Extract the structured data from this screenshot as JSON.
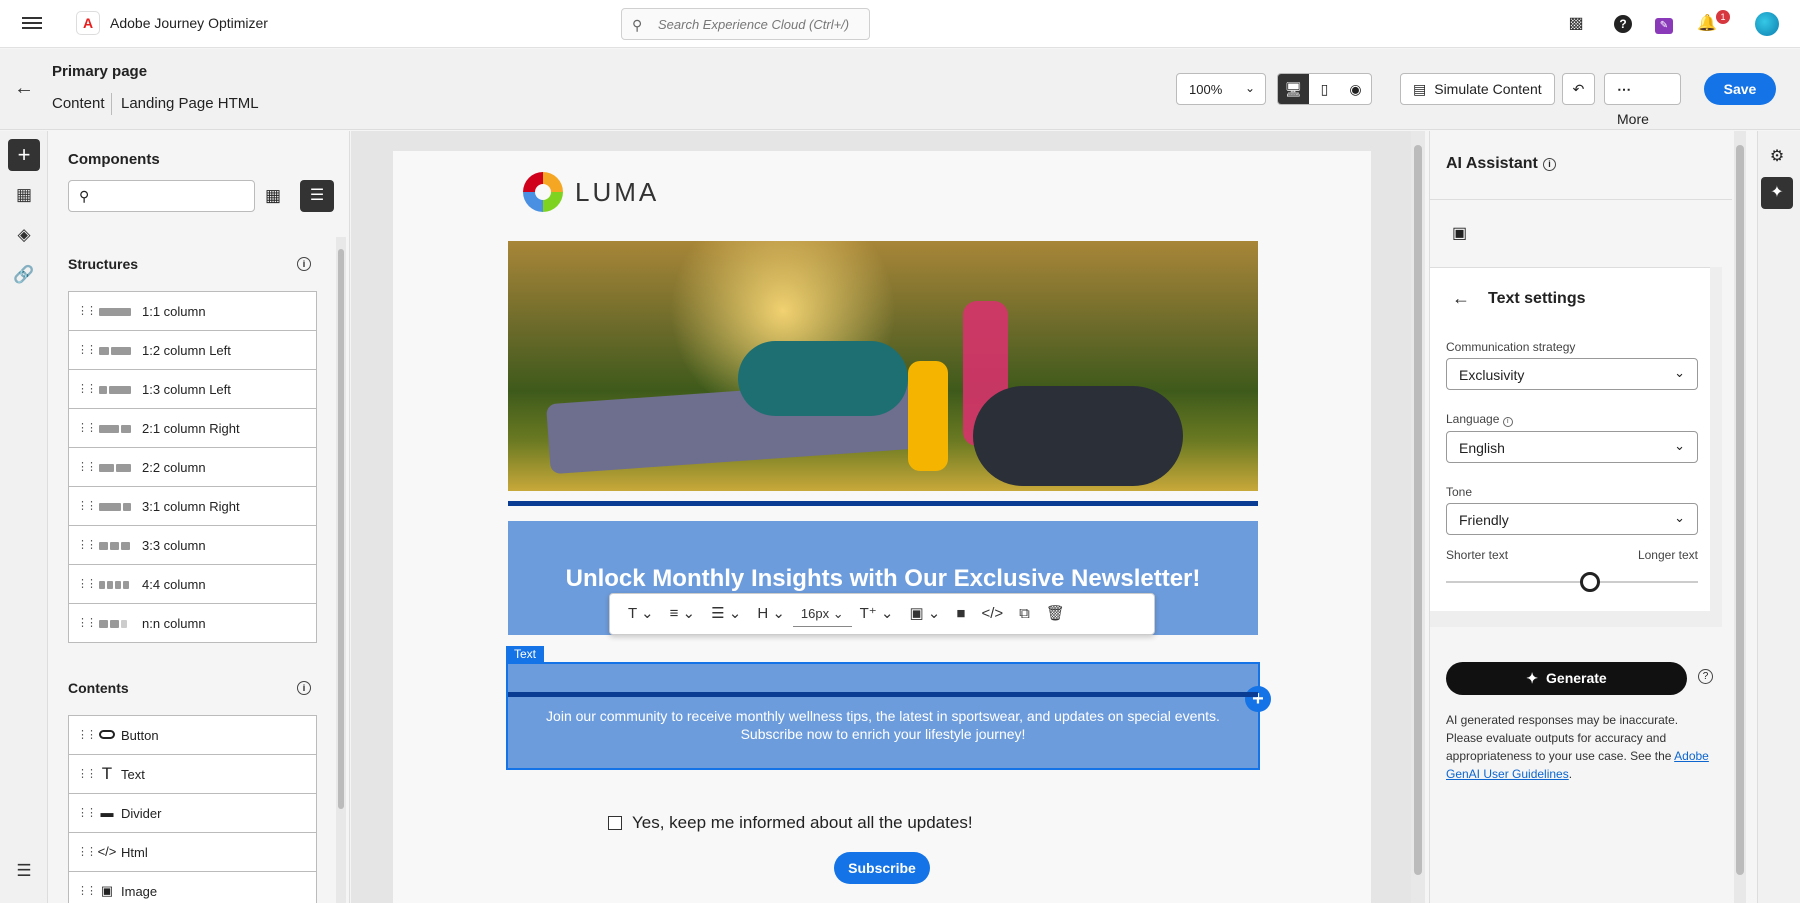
{
  "topbar": {
    "app_title": "Adobe Journey Optimizer",
    "search_placeholder": "Search Experience Cloud (Ctrl+/)",
    "notifications_count": "1"
  },
  "header": {
    "page_title": "Primary page",
    "breadcrumb_content": "Content",
    "breadcrumb_landing": "Landing Page HTML",
    "zoom": "100%",
    "simulate_label": "Simulate Content",
    "more_label": "More",
    "save_label": "Save"
  },
  "components": {
    "title": "Components",
    "structures_title": "Structures",
    "structures": [
      {
        "label": "1:1 column"
      },
      {
        "label": "1:2 column Left"
      },
      {
        "label": "1:3 column Left"
      },
      {
        "label": "2:1 column Right"
      },
      {
        "label": "2:2 column"
      },
      {
        "label": "3:1 column Right"
      },
      {
        "label": "3:3 column"
      },
      {
        "label": "4:4 column"
      },
      {
        "label": "n:n column"
      }
    ],
    "contents_title": "Contents",
    "contents": [
      {
        "label": "Button",
        "icon": "button-icon"
      },
      {
        "label": "Text",
        "icon": "text-icon"
      },
      {
        "label": "Divider",
        "icon": "divider-icon"
      },
      {
        "label": "Html",
        "icon": "code-icon"
      },
      {
        "label": "Image",
        "icon": "image-icon"
      }
    ]
  },
  "canvas": {
    "brand": "LUMA",
    "headline": "Unlock Monthly Insights with Our Exclusive Newsletter!",
    "text_label": "Text",
    "body_line1": "Join our community to receive monthly wellness tips, the latest in sportswear, and updates on special events.",
    "body_line2": "Subscribe now to enrich your lifestyle journey!",
    "font_size": "16px",
    "heading_tool": "H",
    "consent": "Yes, keep me informed about all the updates!",
    "subscribe_label": "Subscribe"
  },
  "ai": {
    "title": "AI Assistant",
    "settings_title": "Text settings",
    "strategy_label": "Communication strategy",
    "strategy_value": "Exclusivity",
    "language_label": "Language",
    "language_value": "English",
    "tone_label": "Tone",
    "tone_value": "Friendly",
    "shorter": "Shorter text",
    "longer": "Longer text",
    "length_slider_value": 0.57,
    "generate_label": "Generate",
    "disclaimer": "AI generated responses may be inaccurate. Please evaluate outputs for accuracy and appropriateness to your use case. See the ",
    "guidelines_link": "Adobe GenAI User Guidelines",
    "disclaimer_end": "."
  },
  "colors": {
    "accent": "#1473e6",
    "dark_blue_bar": "#0b3c93",
    "block_bg": "#6d9cdc"
  }
}
